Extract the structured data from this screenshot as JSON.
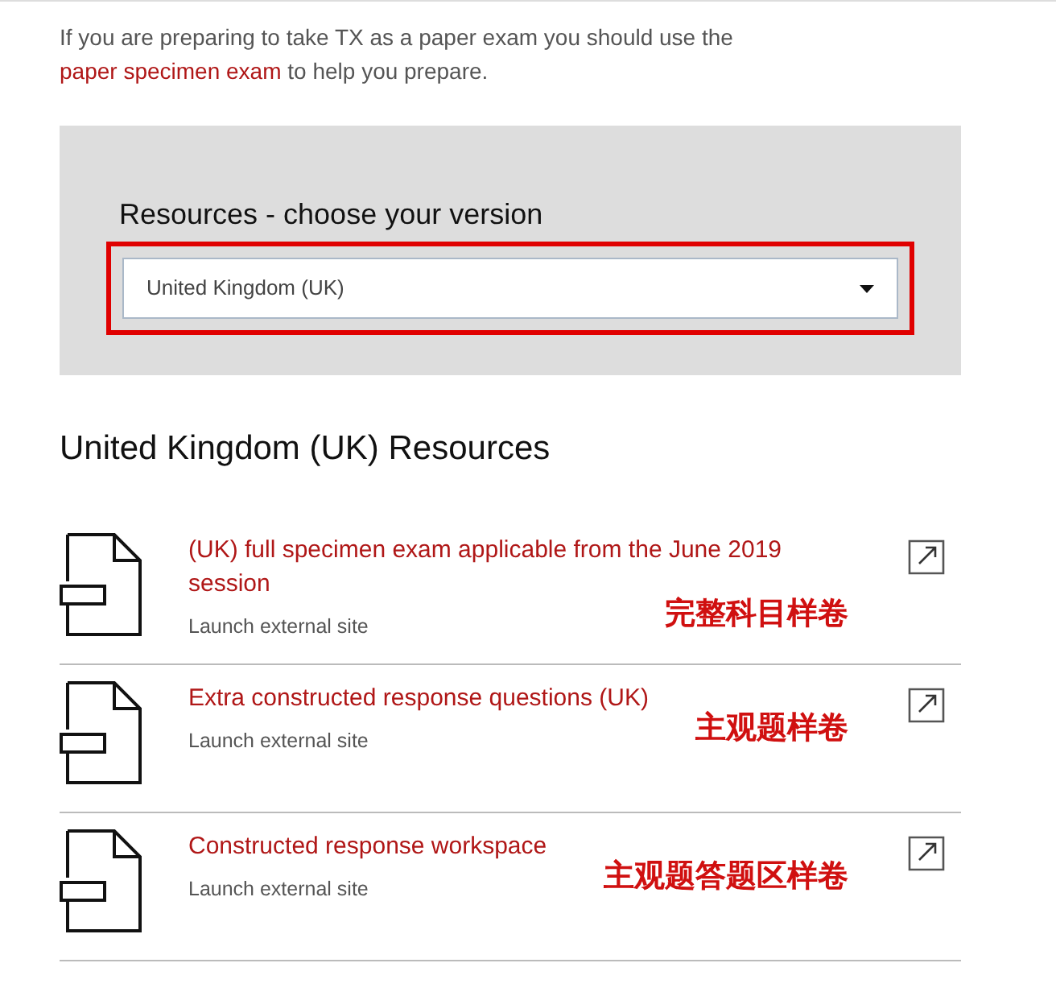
{
  "intro": {
    "text": "If you are preparing to take TX as a paper exam you should use the ",
    "link": "paper specimen exam",
    "after": " to help you prepare."
  },
  "version_panel": {
    "heading": "Resources - choose your version",
    "select": {
      "value": "United Kingdom (UK)",
      "highlighted": true
    }
  },
  "resources_heading": "United Kingdom (UK) Resources",
  "resources": [
    {
      "title": "(UK) full specimen exam applicable from the June 2019 session",
      "subtitle": "Launch external site",
      "annotation": "完整科目样卷"
    },
    {
      "title": "Extra constructed response questions (UK)",
      "subtitle": "Launch external site",
      "annotation": "主观题样卷"
    },
    {
      "title": "Constructed response workspace",
      "subtitle": "Launch external site",
      "annotation": "主观题答题区样卷"
    }
  ]
}
